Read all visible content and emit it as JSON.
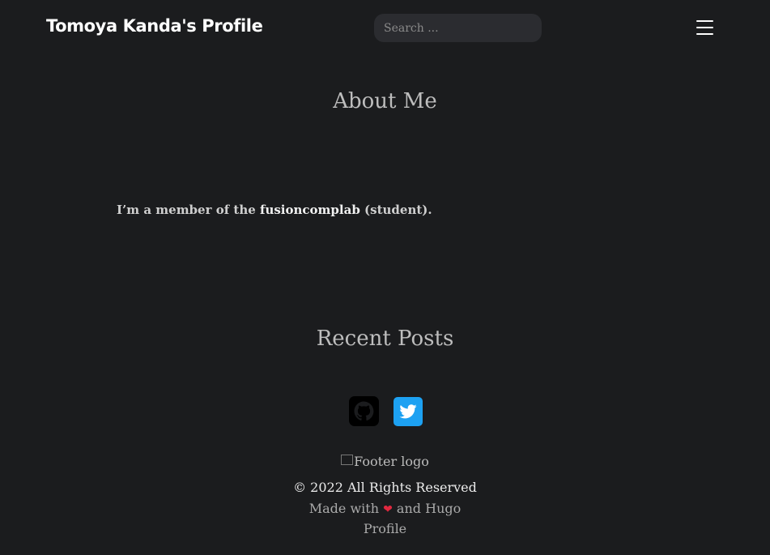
{
  "header": {
    "site_title": "Tomoya Kanda's Profile",
    "search_placeholder": "Search ...",
    "menu_icon": "hamburger-menu-icon"
  },
  "about": {
    "title": "About Me",
    "text_prefix": "I’m a member of the ",
    "lab_link": "fusioncomplab",
    "text_suffix": " (student)."
  },
  "recent_posts": {
    "title": "Recent Posts"
  },
  "social": {
    "github_icon": "github-icon",
    "twitter_icon": "twitter-icon",
    "twitter_color": "#1da1f2"
  },
  "footer": {
    "logo_alt": "Footer logo",
    "copyright": "© 2022 All Rights Reserved",
    "made_with_prefix": "Made with ",
    "heart": "❤",
    "made_with_middle": " and ",
    "theme_name_line1": "Hugo",
    "theme_name_line2": "Profile"
  }
}
